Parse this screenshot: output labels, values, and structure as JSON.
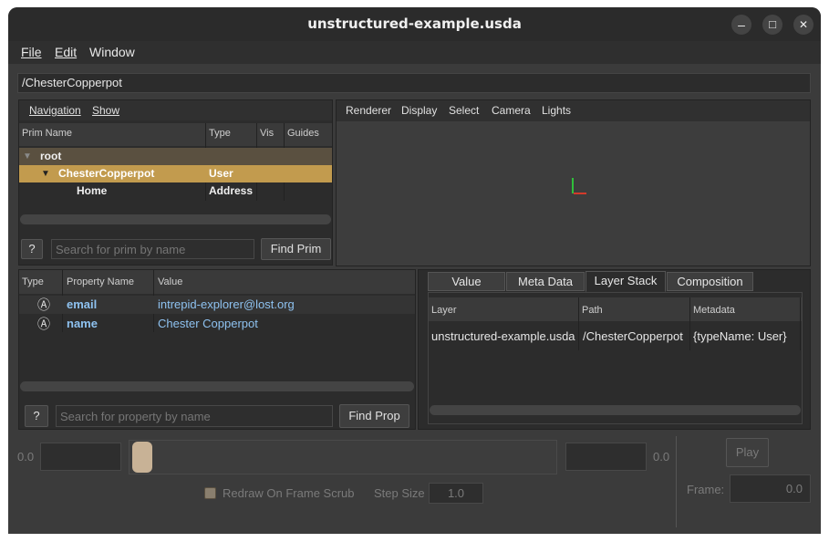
{
  "window": {
    "title": "unstructured-example.usda",
    "minimize": "–",
    "maximize": "□",
    "close": "✕"
  },
  "menu": {
    "file": "File",
    "edit": "Edit",
    "window": "Window"
  },
  "path": "/ChesterCopperpot",
  "navigation": {
    "menu_navigation": "Navigation",
    "menu_show": "Show",
    "columns": [
      "Prim Name",
      "Type",
      "Vis",
      "Guides"
    ],
    "rows": [
      {
        "name": "root",
        "type": "",
        "vis": "",
        "guides": ""
      },
      {
        "name": "ChesterCopperpot",
        "type": "User",
        "vis": "",
        "guides": ""
      },
      {
        "name": "Home",
        "type": "Address",
        "vis": "",
        "guides": ""
      }
    ],
    "help_button": "?",
    "search_placeholder": "Search for prim by name",
    "find_button": "Find Prim"
  },
  "viewport": {
    "menus": [
      "Renderer",
      "Display",
      "Select",
      "Camera",
      "Lights"
    ]
  },
  "properties": {
    "columns": [
      "Type",
      "Property Name",
      "Value"
    ],
    "rows": [
      {
        "type_icon": "Ⓐ",
        "name": "email",
        "value": "intrepid-explorer@lost.org"
      },
      {
        "type_icon": "Ⓐ",
        "name": "name",
        "value": "Chester Copperpot"
      }
    ],
    "help_button": "?",
    "search_placeholder": "Search for property by name",
    "find_button": "Find Prop"
  },
  "inspector": {
    "tabs": [
      "Value",
      "Meta Data",
      "Layer Stack",
      "Composition"
    ],
    "active_tab": "Layer Stack",
    "columns": [
      "Layer",
      "Path",
      "Metadata"
    ],
    "rows": [
      {
        "layer": "unstructured-example.usda",
        "path": "/ChesterCopperpot",
        "metadata": "{typeName: User}"
      }
    ]
  },
  "timeline": {
    "start_label": "0.0",
    "end_label": "0.0",
    "redraw_label": "Redraw On Frame Scrub",
    "step_size_label": "Step Size",
    "step_size_value": "1.0",
    "play_button": "Play",
    "frame_label": "Frame:",
    "frame_value": "0.0"
  }
}
